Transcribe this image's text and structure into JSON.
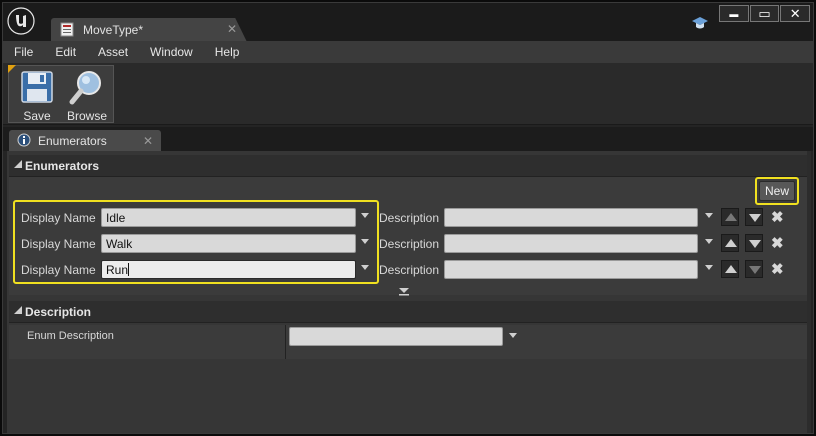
{
  "window": {
    "doc_tab_title": "MoveType*",
    "controls": {
      "minimize": "▬",
      "maximize": "▭",
      "close": "✕"
    }
  },
  "menu": [
    "File",
    "Edit",
    "Asset",
    "Window",
    "Help"
  ],
  "toolbar": {
    "save_label": "Save",
    "browse_label": "Browse"
  },
  "panel_tab": {
    "label": "Enumerators",
    "close": "✕"
  },
  "enumerators_section": {
    "title": "Enumerators",
    "new_button": "New",
    "display_name_label": "Display Name",
    "description_label": "Description",
    "rows": [
      {
        "display_name": "Idle",
        "description": ""
      },
      {
        "display_name": "Walk",
        "description": ""
      },
      {
        "display_name": "Run",
        "description": ""
      }
    ]
  },
  "description_section": {
    "title": "Description",
    "enum_description_label": "Enum Description",
    "enum_description_value": ""
  },
  "colors": {
    "highlight": "#f0e020",
    "accent_corner": "#e0a010"
  },
  "icons": {
    "app_logo": "unreal-engine-logo-icon",
    "doc": "enum-asset-icon",
    "save": "floppy-disk-icon",
    "browse": "magnifier-icon",
    "panel": "details-icon",
    "title_bar_extra": "graduation-cap-icon"
  }
}
